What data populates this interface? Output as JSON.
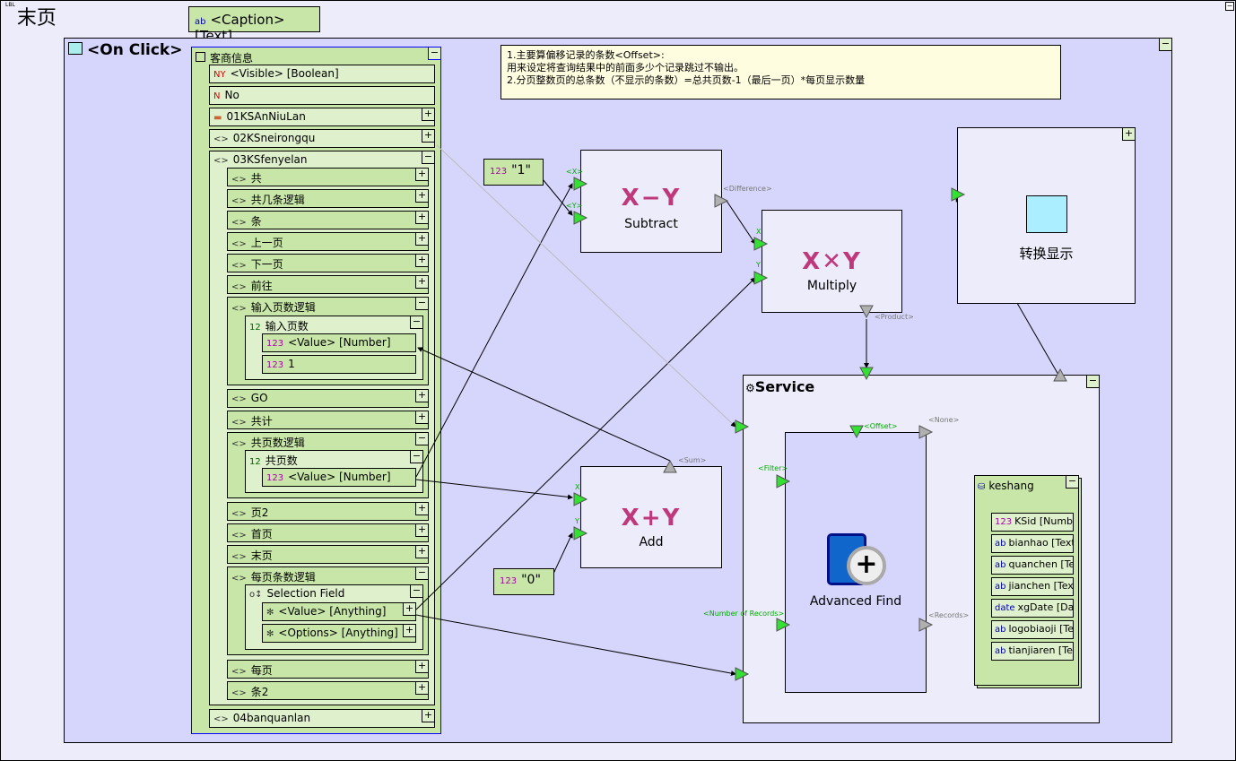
{
  "page": {
    "title": "末页",
    "title_icon": "LBL"
  },
  "caption": {
    "icon": "ab",
    "label": "<Caption> [Text]"
  },
  "on_click": {
    "title": "<On Click>"
  },
  "note": {
    "lines": [
      "1.主要算偏移记录的条数<Offset>:",
      "用来设定将查询结果中的前面多少个记录跳过不输出。",
      "2.分页整数页的总条数（不显示的条数）=总共页数-1（最后一页）*每页显示数量"
    ]
  },
  "tree": {
    "root": "客商信息",
    "items": [
      {
        "label": "<Visible> [Boolean]",
        "icon": "NY"
      },
      {
        "label": "No",
        "icon": "N"
      },
      {
        "label": "01KSAnNiuLan",
        "icon": "▬",
        "btn": "+"
      },
      {
        "label": "02KSneirongqu",
        "icon": "<>",
        "btn": "+"
      },
      {
        "label": "03KSfenyelan",
        "icon": "<>",
        "btn": "−"
      },
      {
        "label": "共",
        "icon": "<>",
        "btn": "+"
      },
      {
        "label": "共几条逻辑",
        "icon": "<>",
        "btn": "+"
      },
      {
        "label": "条",
        "icon": "<>",
        "btn": "+"
      },
      {
        "label": "上一页",
        "icon": "<>",
        "btn": "+"
      },
      {
        "label": "下一页",
        "icon": "<>",
        "btn": "+"
      },
      {
        "label": "前往",
        "icon": "<>",
        "btn": "+"
      },
      {
        "label": "输入页数逻辑",
        "icon": "<>",
        "btn": "−"
      },
      {
        "label": "输入页数",
        "icon": "12",
        "btn": "−"
      },
      {
        "label": "<Value> [Number]",
        "icon": "123"
      },
      {
        "label": "1",
        "icon": "123"
      },
      {
        "label": "GO",
        "icon": "<>",
        "btn": "+"
      },
      {
        "label": "共计",
        "icon": "<>",
        "btn": "+"
      },
      {
        "label": "共页数逻辑",
        "icon": "<>",
        "btn": "−"
      },
      {
        "label": "共页数",
        "icon": "12",
        "btn": "−"
      },
      {
        "label": "<Value> [Number]",
        "icon": "123"
      },
      {
        "label": "页2",
        "icon": "<>",
        "btn": "+"
      },
      {
        "label": "首页",
        "icon": "<>",
        "btn": "+"
      },
      {
        "label": "末页",
        "icon": "<>",
        "btn": "+"
      },
      {
        "label": "每页条数逻辑",
        "icon": "<>",
        "btn": "−"
      },
      {
        "label": "Selection Field",
        "icon": "o↕",
        "btn": "−"
      },
      {
        "label": "<Value> [Anything]",
        "icon": "✻",
        "btn": "+"
      },
      {
        "label": "<Options> [Anything]",
        "icon": "✻",
        "btn": "+"
      },
      {
        "label": "每页",
        "icon": "<>",
        "btn": "+"
      },
      {
        "label": "条2",
        "icon": "<>",
        "btn": "+"
      },
      {
        "label": "04banquanlan",
        "icon": "<>",
        "btn": "+"
      }
    ]
  },
  "nodes": {
    "const1": "\"1\"",
    "const0": "\"0\"",
    "subtract": {
      "op": "X−Y",
      "label": "Subtract",
      "x": "<X>",
      "y": "<Y>",
      "out": "<Difference>"
    },
    "multiply": {
      "op": "X✕Y",
      "label": "Multiply",
      "x": "X",
      "y": "Y",
      "out": "<Product>"
    },
    "add": {
      "op": "X+Y",
      "label": "Add",
      "x": "X",
      "y": "Y",
      "out": "<Sum>"
    },
    "convert": {
      "label": "转换显示"
    },
    "service": {
      "title": "Service"
    },
    "find": {
      "label": "Advanced Find",
      "offset": "<Offset>",
      "none": "<None>",
      "filter": "<Filter>",
      "num": "<Number of Records>",
      "records": "<Records>"
    },
    "keshang": {
      "title": "keshang",
      "fields": [
        "KSid [Number]",
        "bianhao [Text]",
        "quanchen [Text]",
        "jianchen [Text]",
        "xgDate [Date]",
        "logobiaoji [Text]",
        "tianjiaren [Text]"
      ],
      "icons": [
        "123",
        "ab",
        "ab",
        "ab",
        "date",
        "ab",
        "ab"
      ]
    }
  },
  "colors": {
    "port_in": "#33e033",
    "port_out": "#b0b0b0",
    "op": "#c0387c",
    "field_bg": "#c8e6a8",
    "canvas": "#d6d6fc"
  }
}
